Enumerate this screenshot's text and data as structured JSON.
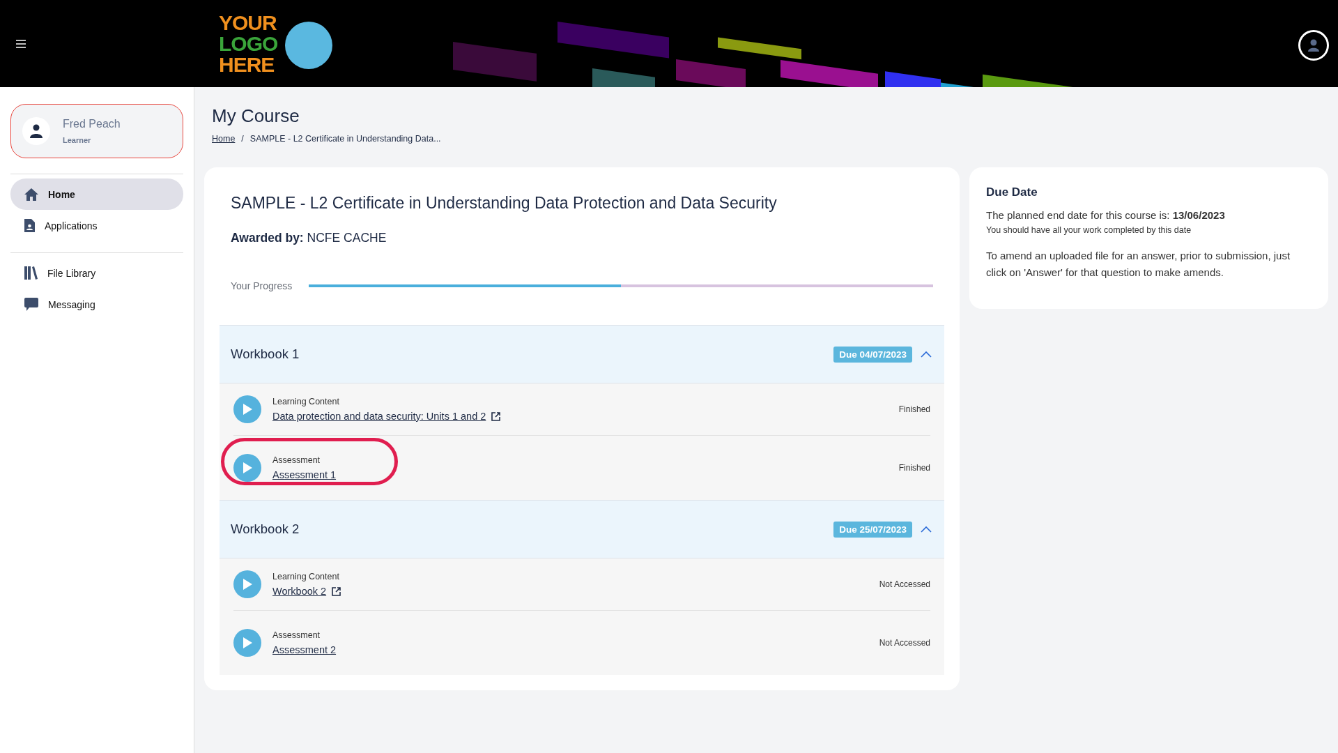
{
  "header": {
    "logo": {
      "lines": [
        "YOUR",
        "LOGO",
        "HERE"
      ]
    }
  },
  "profile": {
    "name": "Fred Peach",
    "role": "Learner"
  },
  "sidebar": {
    "groups": [
      {
        "items": [
          {
            "label": "Home",
            "kind": "home",
            "selected": true
          },
          {
            "label": "Applications",
            "kind": "applications",
            "selected": false
          }
        ]
      },
      {
        "items": [
          {
            "label": "File Library",
            "kind": "library",
            "selected": false
          },
          {
            "label": "Messaging",
            "kind": "messaging",
            "selected": false
          }
        ]
      }
    ]
  },
  "page": {
    "title": "My Course",
    "breadcrumb_separator": "/",
    "breadcrumb": [
      "Home",
      "SAMPLE - L2 Certificate in Understanding Data..."
    ]
  },
  "course": {
    "title": "SAMPLE - L2 Certificate in Understanding Data Protection and Data Security",
    "awarded_label": "Awarded by:",
    "awarded_by": "NCFE CACHE",
    "progress_label": "Your Progress",
    "progress": {
      "level": 0.5
    },
    "workbooks": [
      {
        "title": "Workbook 1",
        "due": "Due 04/07/2023",
        "expanded": true,
        "items": [
          {
            "type": "Learning Content",
            "link": "Data protection and data security: Units 1 and 2",
            "external": true,
            "status": "Finished",
            "highlighted": false
          },
          {
            "type": "Assessment",
            "link": "Assessment 1",
            "external": false,
            "status": "Finished",
            "highlighted": true
          }
        ]
      },
      {
        "title": "Workbook 2",
        "due": "Due 25/07/2023",
        "expanded": true,
        "items": [
          {
            "type": "Learning Content",
            "link": "Workbook 2",
            "external": true,
            "status": "Not Accessed",
            "highlighted": false
          },
          {
            "type": "Assessment",
            "link": "Assessment 2",
            "external": false,
            "status": "Not Accessed",
            "highlighted": false
          }
        ]
      }
    ]
  },
  "due_card": {
    "title": "Due Date",
    "planned": "The planned end date for this course is: **13/06/2023**",
    "note": "You should have all your work completed by this date",
    "info": "To amend an uploaded file for an answer, prior to submission, just click on 'Answer' for that question to make amends."
  }
}
